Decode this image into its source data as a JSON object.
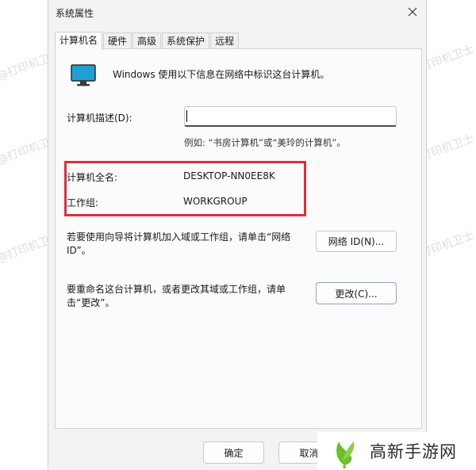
{
  "window": {
    "title": "系统属性",
    "close_icon": "close-icon"
  },
  "tabs": [
    {
      "label": "计算机名",
      "active": true
    },
    {
      "label": "硬件",
      "active": false
    },
    {
      "label": "高级",
      "active": false
    },
    {
      "label": "系统保护",
      "active": false
    },
    {
      "label": "远程",
      "active": false
    }
  ],
  "panel": {
    "intro": "Windows 使用以下信息在网络中标识这台计算机。",
    "description_label": "计算机描述(D):",
    "description_value": "",
    "example_text": "例如: “书房计算机”或“美玲的计算机”。",
    "full_name_label": "计算机全名:",
    "full_name_value": "DESKTOP-NN0EE8K",
    "workgroup_label": "工作组:",
    "workgroup_value": "WORKGROUP",
    "network_id_text": "若要使用向导将计算机加入域或工作组，请单击“网络 ID”。",
    "network_id_button": "网络 ID(N)...",
    "rename_text": "要重命名这台计算机，或者更改其域或工作组，请单击“更改”。",
    "change_button": "更改(C)..."
  },
  "footer": {
    "ok_button": "确定",
    "cancel_button": "取消"
  },
  "watermark_text": "@打印机卫士",
  "brand": {
    "name": "高新手游网",
    "logo_icon": "leaf-logo-icon"
  },
  "colors": {
    "highlight_border": "#e12d39",
    "monitor_screen": "#1ea0d6",
    "brand_green": "#6cbf2f"
  }
}
